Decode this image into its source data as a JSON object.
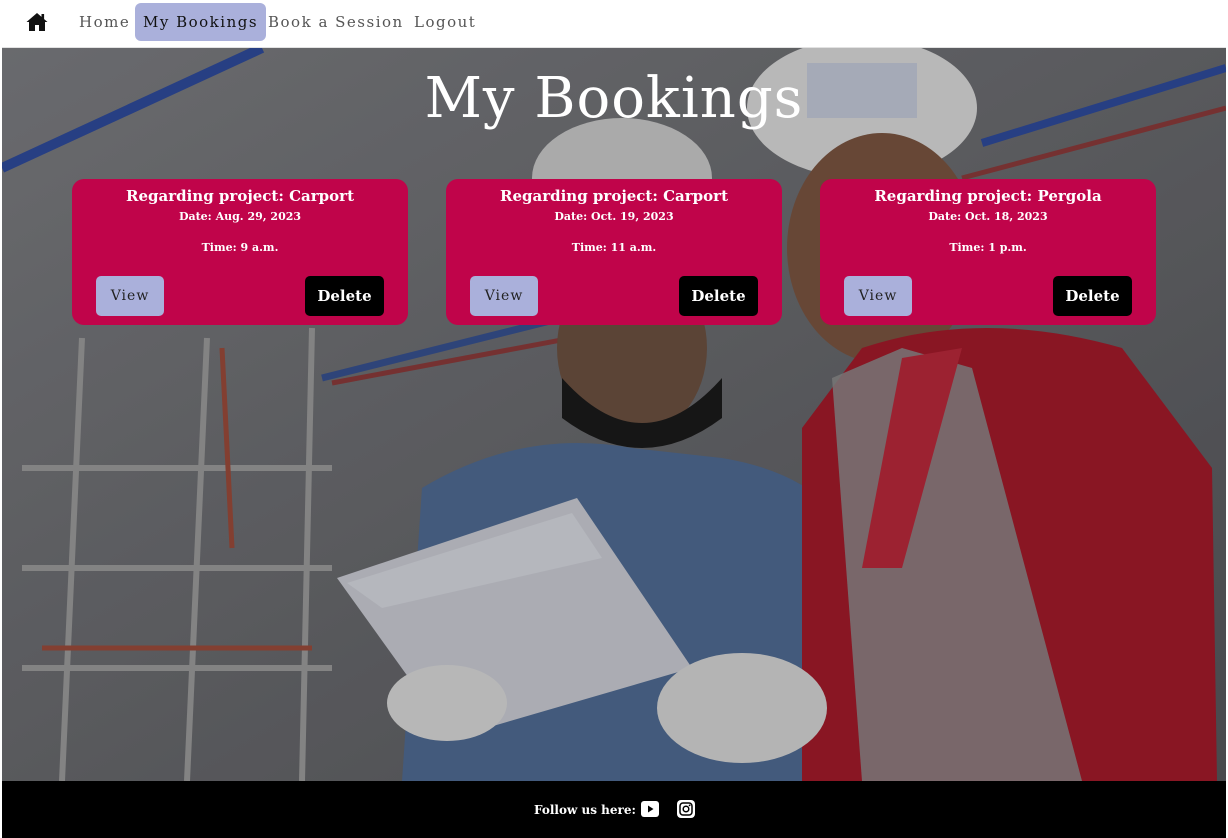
{
  "nav": {
    "home_icon": "home-icon",
    "links": [
      {
        "label": "Home",
        "active": false
      },
      {
        "label": "My Bookings",
        "active": true
      },
      {
        "label": "Book a Session",
        "active": false
      },
      {
        "label": "Logout",
        "active": false
      }
    ]
  },
  "page": {
    "title": "My Bookings"
  },
  "bookings": [
    {
      "project": "Regarding project: Carport",
      "date": "Date: Aug. 29, 2023",
      "time": "Time: 9 a.m.",
      "view_label": "View",
      "delete_label": "Delete"
    },
    {
      "project": "Regarding project: Carport",
      "date": "Date: Oct. 19, 2023",
      "time": "Time: 11 a.m.",
      "view_label": "View",
      "delete_label": "Delete"
    },
    {
      "project": "Regarding project: Pergola",
      "date": "Date: Oct. 18, 2023",
      "time": "Time: 1 p.m.",
      "view_label": "View",
      "delete_label": "Delete"
    }
  ],
  "footer": {
    "follow_text": "Follow us here:",
    "icons": [
      "youtube-icon",
      "instagram-icon"
    ]
  },
  "colors": {
    "card_bg": "#c0044a",
    "view_button": "#aab0db",
    "delete_button": "#000000",
    "active_nav": "#aab0db",
    "footer_bg": "#000000"
  }
}
